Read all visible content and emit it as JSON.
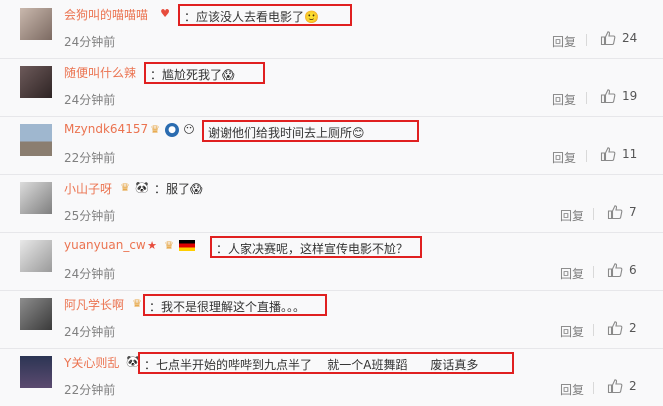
{
  "comments": [
    {
      "name": "会狗叫的喵喵喵",
      "badges": [
        {
          "icon": "heart-crown-icon",
          "glyph": "♥"
        }
      ],
      "sep": "：",
      "text": "应该没人去看电影了",
      "emoji": "🙂",
      "time": "24分钟前",
      "reply": "回复",
      "likes": "24"
    },
    {
      "name": "随便叫什么辣",
      "badges": [],
      "sep": "：",
      "text": "尴尬死我了",
      "emoji": "😱",
      "time": "24分钟前",
      "reply": "回复",
      "likes": "19"
    },
    {
      "name": "Mzyndk64157",
      "badges": [
        {
          "icon": "crown-icon",
          "glyph": "♛"
        },
        {
          "icon": "round-badge-icon",
          "glyph": "●"
        },
        {
          "icon": "face-icon",
          "glyph": "😶"
        }
      ],
      "sep": "",
      "text": "谢谢他们给我时间去上厕所",
      "emoji": "😊",
      "time": "22分钟前",
      "reply": "回复",
      "likes": "11"
    },
    {
      "name": "小山子呀",
      "badges": [
        {
          "icon": "crown-icon",
          "glyph": "♛"
        },
        {
          "icon": "panda-icon",
          "glyph": "🐼"
        }
      ],
      "sep": "：",
      "text": "服了",
      "emoji": "😱",
      "time": "25分钟前",
      "reply": "回复",
      "likes": "7"
    },
    {
      "name": "yuanyuan_cw",
      "badges": [
        {
          "icon": "star-icon",
          "glyph": "★"
        },
        {
          "icon": "crown-icon",
          "glyph": "♛"
        },
        {
          "icon": "germany-flag-icon",
          "glyph": ""
        }
      ],
      "sep": "：",
      "text": "人家决赛呢，这样宣传电影不尬？",
      "emoji": "",
      "time": "24分钟前",
      "reply": "回复",
      "likes": "6"
    },
    {
      "name": "阿凡学长啊",
      "badges": [
        {
          "icon": "crown-icon",
          "glyph": "♛"
        }
      ],
      "sep": "：",
      "text": "我不是很理解这个直播。。。",
      "emoji": "",
      "time": "24分钟前",
      "reply": "回复",
      "likes": "2"
    },
    {
      "name": "Y关心则乱",
      "badges": [
        {
          "icon": "panda-icon",
          "glyph": "🐼"
        }
      ],
      "sep": "：",
      "text": "七点半开始的哔哔到九点半了    就一个A班舞蹈      废话真多",
      "emoji": "",
      "time": "22分钟前",
      "reply": "回复",
      "likes": "2"
    }
  ]
}
